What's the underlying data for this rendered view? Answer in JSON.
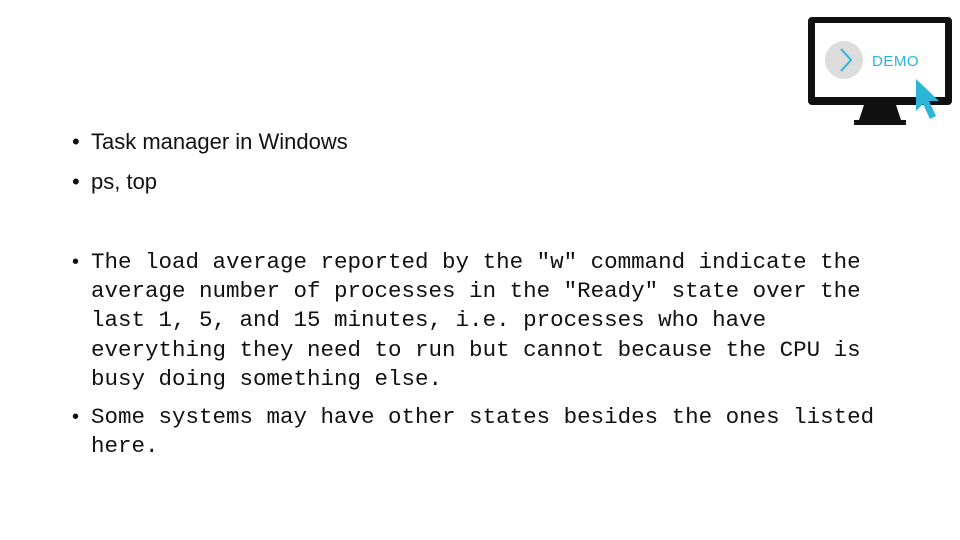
{
  "slide": {
    "demo_badge": {
      "label": "DEMO",
      "accent_color": "#29b6d8",
      "circle_color": "#dcdcdc",
      "frame_color": "#111111"
    },
    "top_bullets": [
      "Task manager in Windows",
      "ps, top"
    ],
    "main_bullets": [
      "The load average reported by the \"w\" command indicate the\naverage number of processes in the \"Ready\" state over the\nlast 1, 5, and 15 minutes, i.e. processes who have\neverything they need to run but cannot because the CPU is\nbusy doing something else.",
      "Some systems may have other states besides the ones listed\nhere."
    ]
  }
}
